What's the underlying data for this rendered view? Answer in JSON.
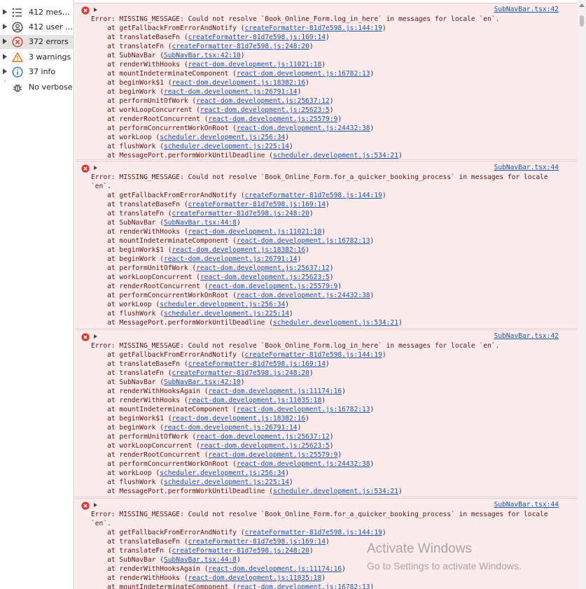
{
  "sidebar": {
    "items": [
      {
        "label": "412 messa...",
        "icon": "list-icon"
      },
      {
        "label": "412 user m...",
        "icon": "user-icon"
      },
      {
        "label": "372 errors",
        "icon": "error-icon"
      },
      {
        "label": "3 warnings",
        "icon": "warning-icon"
      },
      {
        "label": "37 info",
        "icon": "info-icon"
      },
      {
        "label": "No verbose",
        "icon": "bug-icon"
      }
    ]
  },
  "console": {
    "entries": [
      {
        "source": "SubNavBar.tsx:42",
        "message": "Error: MISSING_MESSAGE: Could not resolve `Book_Online_Form.log_in_here` in messages for locale `en`.",
        "frames": [
          {
            "fn": "getFallbackFromErrorAndNotify",
            "loc": "createFormatter-81d7e598.js:144:19"
          },
          {
            "fn": "translateBaseFn",
            "loc": "createFormatter-81d7e598.js:169:14"
          },
          {
            "fn": "translateFn",
            "loc": "createFormatter-81d7e598.js:248:20"
          },
          {
            "fn": "SubNavBar",
            "loc": "SubNavBar.tsx:42:10"
          },
          {
            "fn": "renderWithHooks",
            "loc": "react-dom.development.js:11021:18"
          },
          {
            "fn": "mountIndeterminateComponent",
            "loc": "react-dom.development.js:16782:13"
          },
          {
            "fn": "beginWork$1",
            "loc": "react-dom.development.js:18382:16"
          },
          {
            "fn": "beginWork",
            "loc": "react-dom.development.js:26791:14"
          },
          {
            "fn": "performUnitOfWork",
            "loc": "react-dom.development.js:25637:12"
          },
          {
            "fn": "workLoopConcurrent",
            "loc": "react-dom.development.js:25623:5"
          },
          {
            "fn": "renderRootConcurrent",
            "loc": "react-dom.development.js:25579:9"
          },
          {
            "fn": "performConcurrentWorkOnRoot",
            "loc": "react-dom.development.js:24432:38"
          },
          {
            "fn": "workLoop",
            "loc": "scheduler.development.js:256:34"
          },
          {
            "fn": "flushWork",
            "loc": "scheduler.development.js:225:14"
          },
          {
            "fn": "MessagePort.performWorkUntilDeadline",
            "loc": "scheduler.development.js:534:21"
          }
        ]
      },
      {
        "source": "SubNavBar.tsx:44",
        "message": "Error: MISSING_MESSAGE: Could not resolve `Book_Online_Form.for_a_quicker_booking_process` in messages for locale\n`en`.",
        "frames": [
          {
            "fn": "getFallbackFromErrorAndNotify",
            "loc": "createFormatter-81d7e598.js:144:19"
          },
          {
            "fn": "translateBaseFn",
            "loc": "createFormatter-81d7e598.js:169:14"
          },
          {
            "fn": "translateFn",
            "loc": "createFormatter-81d7e598.js:248:20"
          },
          {
            "fn": "SubNavBar",
            "loc": "SubNavBar.tsx:44:8"
          },
          {
            "fn": "renderWithHooks",
            "loc": "react-dom.development.js:11021:18"
          },
          {
            "fn": "mountIndeterminateComponent",
            "loc": "react-dom.development.js:16782:13"
          },
          {
            "fn": "beginWork$1",
            "loc": "react-dom.development.js:18382:16"
          },
          {
            "fn": "beginWork",
            "loc": "react-dom.development.js:26791:14"
          },
          {
            "fn": "performUnitOfWork",
            "loc": "react-dom.development.js:25637:12"
          },
          {
            "fn": "workLoopConcurrent",
            "loc": "react-dom.development.js:25623:5"
          },
          {
            "fn": "renderRootConcurrent",
            "loc": "react-dom.development.js:25579:9"
          },
          {
            "fn": "performConcurrentWorkOnRoot",
            "loc": "react-dom.development.js:24432:38"
          },
          {
            "fn": "workLoop",
            "loc": "scheduler.development.js:256:34"
          },
          {
            "fn": "flushWork",
            "loc": "scheduler.development.js:225:14"
          },
          {
            "fn": "MessagePort.performWorkUntilDeadline",
            "loc": "scheduler.development.js:534:21"
          }
        ]
      },
      {
        "source": "SubNavBar.tsx:42",
        "message": "Error: MISSING_MESSAGE: Could not resolve `Book_Online_Form.log_in_here` in messages for locale `en`.",
        "frames": [
          {
            "fn": "getFallbackFromErrorAndNotify",
            "loc": "createFormatter-81d7e598.js:144:19"
          },
          {
            "fn": "translateBaseFn",
            "loc": "createFormatter-81d7e598.js:169:14"
          },
          {
            "fn": "translateFn",
            "loc": "createFormatter-81d7e598.js:248:20"
          },
          {
            "fn": "SubNavBar",
            "loc": "SubNavBar.tsx:42:10"
          },
          {
            "fn": "renderWithHooksAgain",
            "loc": "react-dom.development.js:11174:16"
          },
          {
            "fn": "renderWithHooks",
            "loc": "react-dom.development.js:11035:18"
          },
          {
            "fn": "mountIndeterminateComponent",
            "loc": "react-dom.development.js:16782:13"
          },
          {
            "fn": "beginWork$1",
            "loc": "react-dom.development.js:18382:16"
          },
          {
            "fn": "beginWork",
            "loc": "react-dom.development.js:26791:14"
          },
          {
            "fn": "performUnitOfWork",
            "loc": "react-dom.development.js:25637:12"
          },
          {
            "fn": "workLoopConcurrent",
            "loc": "react-dom.development.js:25623:5"
          },
          {
            "fn": "renderRootConcurrent",
            "loc": "react-dom.development.js:25579:9"
          },
          {
            "fn": "performConcurrentWorkOnRoot",
            "loc": "react-dom.development.js:24432:38"
          },
          {
            "fn": "workLoop",
            "loc": "scheduler.development.js:256:34"
          },
          {
            "fn": "flushWork",
            "loc": "scheduler.development.js:225:14"
          },
          {
            "fn": "MessagePort.performWorkUntilDeadline",
            "loc": "scheduler.development.js:534:21"
          }
        ]
      },
      {
        "source": "SubNavBar.tsx:44",
        "message": "Error: MISSING_MESSAGE: Could not resolve `Book_Online_Form.for_a_quicker_booking_process` in messages for locale\n`en`.",
        "frames": [
          {
            "fn": "getFallbackFromErrorAndNotify",
            "loc": "createFormatter-81d7e598.js:144:19"
          },
          {
            "fn": "translateBaseFn",
            "loc": "createFormatter-81d7e598.js:169:14"
          },
          {
            "fn": "translateFn",
            "loc": "createFormatter-81d7e598.js:248:20"
          },
          {
            "fn": "SubNavBar",
            "loc": "SubNavBar.tsx:44:8"
          },
          {
            "fn": "renderWithHooksAgain",
            "loc": "react-dom.development.js:11174:16"
          },
          {
            "fn": "renderWithHooks",
            "loc": "react-dom.development.js:11035:18"
          },
          {
            "fn": "mountIndeterminateComponent",
            "loc": "react-dom.development.js:16782:13"
          }
        ]
      }
    ]
  },
  "watermark": {
    "title": "Activate Windows",
    "subtitle": "Go to Settings to activate Windows."
  },
  "colors": {
    "error_bg": "#fcebeb",
    "error_text": "#5c1414",
    "link": "#1a55a8",
    "error_icon": "#dc362e"
  }
}
